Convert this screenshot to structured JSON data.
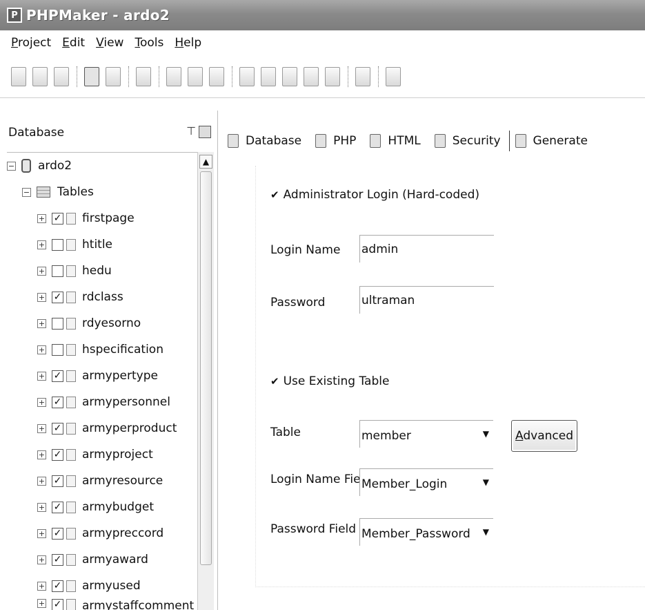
{
  "window": {
    "title": "PHPMaker - ardo2"
  },
  "menu": [
    "Project",
    "Edit",
    "View",
    "Tools",
    "Help"
  ],
  "left_panel": {
    "title": "Database",
    "tree": {
      "root": "ardo2",
      "tables_label": "Tables",
      "tables": [
        {
          "name": "firstpage",
          "checked": true
        },
        {
          "name": "htitle",
          "checked": false
        },
        {
          "name": "hedu",
          "checked": false
        },
        {
          "name": "rdclass",
          "checked": true
        },
        {
          "name": "rdyesorno",
          "checked": false
        },
        {
          "name": "hspecification",
          "checked": false
        },
        {
          "name": "armypertype",
          "checked": true
        },
        {
          "name": "armypersonnel",
          "checked": true
        },
        {
          "name": "armyperproduct",
          "checked": true
        },
        {
          "name": "armyproject",
          "checked": true
        },
        {
          "name": "armyresource",
          "checked": true
        },
        {
          "name": "armybudget",
          "checked": true
        },
        {
          "name": "armypreccord",
          "checked": true
        },
        {
          "name": "armyaward",
          "checked": true
        },
        {
          "name": "armyused",
          "checked": true
        },
        {
          "name": "armystaffcomment",
          "checked": true
        }
      ]
    }
  },
  "tabs": [
    "Database",
    "PHP",
    "HTML",
    "Security",
    "Generate"
  ],
  "security": {
    "admin_login_label": "Administrator Login (Hard-coded)",
    "login_name_label": "Login Name",
    "login_name_value": "admin",
    "password_label": "Password",
    "password_value": "ultraman",
    "use_existing_label": "Use Existing Table",
    "table_label": "Table",
    "table_value": "member",
    "advanced_label": "Advanced",
    "login_field_label": "Login Name Field",
    "login_field_value": "Member_Login",
    "password_field_label": "Password Field",
    "password_field_value": "Member_Password"
  }
}
